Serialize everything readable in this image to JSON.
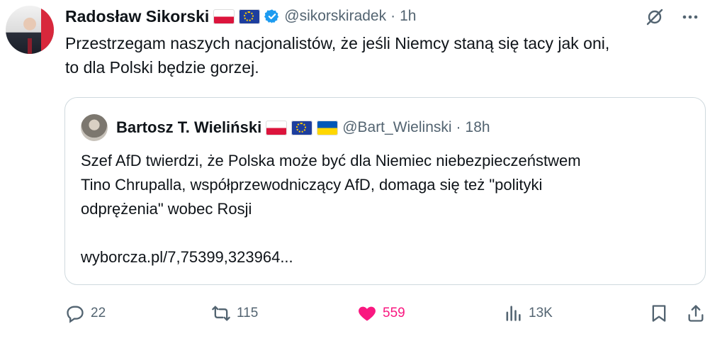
{
  "tweet": {
    "author_name": "Radosław Sikorski",
    "handle": "@sikorskiradek",
    "dot": "·",
    "time": "1h",
    "text_line1": "Przestrzegam naszych nacjonalistów, że jeśli Niemcy staną się tacy jak oni,",
    "text_line2": "to dla Polski będzie gorzej.",
    "author_flags": [
      "poland-flag",
      "eu-flag"
    ],
    "verified_color": "#1d9bf0"
  },
  "quote": {
    "author_name": "Bartosz T. Wieliński",
    "handle": "@Bart_Wielinski",
    "dot": "·",
    "time": "18h",
    "text_line1": "Szef AfD twierdzi, że Polska może być dla Niemiec niebezpieczeństwem",
    "text_line2": "Tino Chrupalla, współprzewodniczący AfD, domaga się też \"polityki",
    "text_line3": "odprężenia\" wobec Rosji",
    "link": "wyborcza.pl/7,75399,323964..."
  },
  "actions": {
    "replies": "22",
    "reposts": "115",
    "likes": "559",
    "views": "13K",
    "like_color": "#f91880"
  }
}
